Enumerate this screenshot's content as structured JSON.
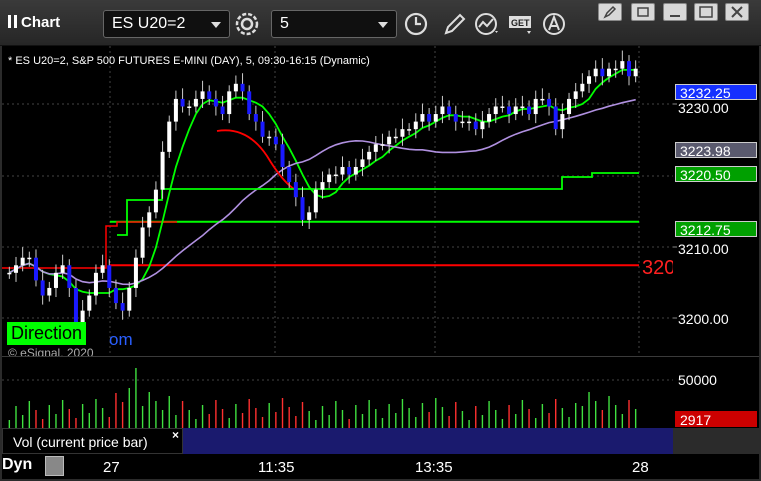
{
  "app": {
    "title": "Chart",
    "symbol": "ES U20=2",
    "interval": "5"
  },
  "toolbar": {
    "icons": [
      "settings-gear-icon",
      "clock-icon",
      "pencil-draw-icon",
      "study-curve-icon",
      "get-data-icon",
      "cursor-text-icon"
    ]
  },
  "window_controls": [
    "edit-icon",
    "restore-icon",
    "maximize-icon",
    "close-icon"
  ],
  "chart": {
    "header": "* ES U20=2, S&P 500 FUTURES E-MINI (DAY), 5, 09:30-16:15 (Dynamic)",
    "copyright": "© eSignal, 2020",
    "overlay_label": "Direction",
    "overlay_fragment": "om",
    "red_overlay_text": "320",
    "price_axis_labels": [
      "3230.00",
      "3210.00",
      "3200.00"
    ],
    "price_tags": [
      {
        "value": "3232.25",
        "bg": "#1530ff"
      },
      {
        "value": "3223.98",
        "bg": "#5a5a6e"
      },
      {
        "value": "3220.50",
        "bg": "#00a000"
      },
      {
        "value": "3212.75",
        "bg": "#00a000"
      }
    ],
    "volume_axis_label": "50000",
    "volume_tag": {
      "value": "2917",
      "bg": "#cc0000"
    },
    "time_labels": [
      "27",
      "11:35",
      "13:35",
      "28"
    ],
    "study_label": "Vol (current price bar)",
    "study_close": "×",
    "dyn_label": "Dyn",
    "colors": {
      "up_candle": "#ffffff",
      "down_candle": "#1a1aff",
      "ma_green": "#00ff00",
      "ma_red": "#ff0000",
      "ma_purple": "#b090e0",
      "level_red": "#ff0000",
      "level_green": "#00ff00"
    }
  },
  "chart_data": {
    "type": "candlestick",
    "ylim": [
      3195,
      3236
    ],
    "levels": [
      {
        "name": "",
        "value": 3212.75
      },
      {
        "name": "",
        "value": 3207.0
      }
    ],
    "last_price": 3232.25
  }
}
